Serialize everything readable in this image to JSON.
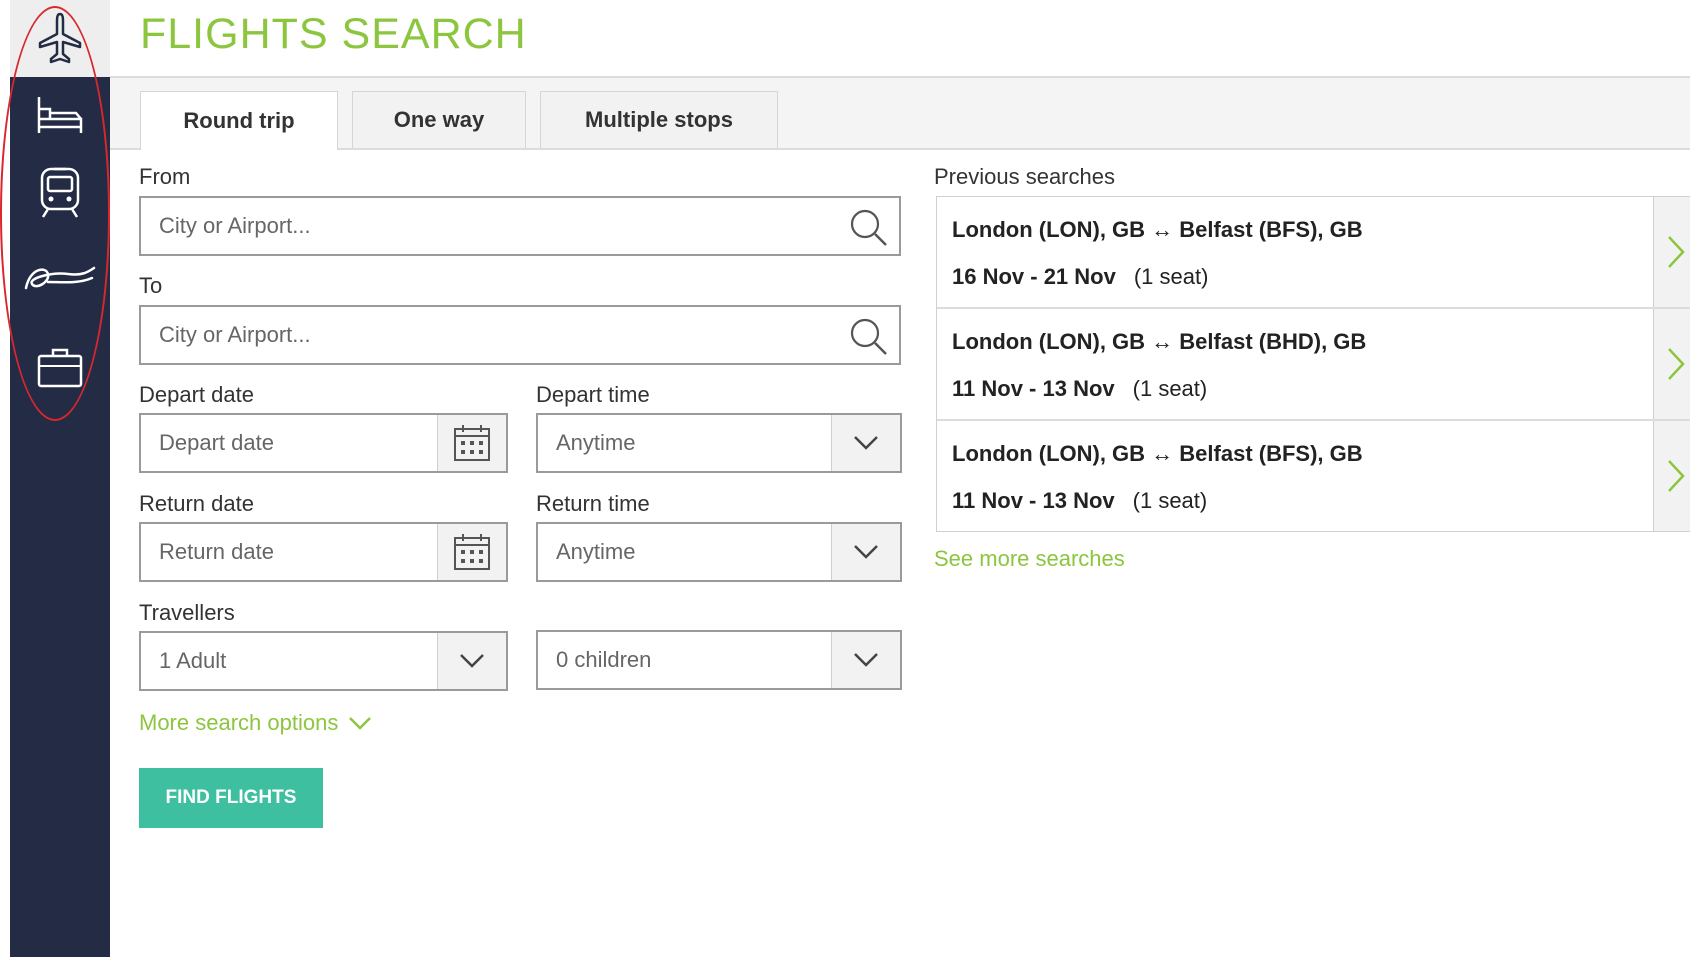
{
  "sidebar": {
    "items": [
      {
        "name": "flights",
        "icon": "airplane-icon"
      },
      {
        "name": "hotels",
        "icon": "bed-icon"
      },
      {
        "name": "trains",
        "icon": "train-icon"
      },
      {
        "name": "car-hire",
        "icon": "car-icon"
      },
      {
        "name": "trips",
        "icon": "briefcase-icon"
      }
    ]
  },
  "header": {
    "title": "FLIGHTS SEARCH"
  },
  "tabs": [
    {
      "label": "Round trip",
      "active": true
    },
    {
      "label": "One way",
      "active": false
    },
    {
      "label": "Multiple stops",
      "active": false
    }
  ],
  "form": {
    "from": {
      "label": "From",
      "placeholder": "City or Airport..."
    },
    "to": {
      "label": "To",
      "placeholder": "City or Airport..."
    },
    "depart_date": {
      "label": "Depart date",
      "placeholder": "Depart date"
    },
    "depart_time": {
      "label": "Depart time",
      "value": "Anytime"
    },
    "return_date": {
      "label": "Return date",
      "placeholder": "Return date"
    },
    "return_time": {
      "label": "Return time",
      "value": "Anytime"
    },
    "travellers": {
      "label": "Travellers",
      "adults": "1 Adult",
      "children": "0 children"
    },
    "more_options": "More search options",
    "submit": "FIND FLIGHTS"
  },
  "previous": {
    "title": "Previous searches",
    "items": [
      {
        "route": "London (LON), GB ↔ Belfast (BFS), GB",
        "dates": "16 Nov - 21 Nov",
        "seats": "(1 seat)"
      },
      {
        "route": "London (LON), GB ↔ Belfast (BHD), GB",
        "dates": "11 Nov - 13 Nov",
        "seats": "(1 seat)"
      },
      {
        "route": "London (LON), GB ↔ Belfast (BFS), GB",
        "dates": "11 Nov - 13 Nov",
        "seats": "(1 seat)"
      }
    ],
    "see_more": "See more searches"
  },
  "colors": {
    "accent_green": "#8cc63f",
    "button_teal": "#3dbfa0",
    "sidebar_navy": "#232b45",
    "annotation_red": "#d9272e"
  }
}
